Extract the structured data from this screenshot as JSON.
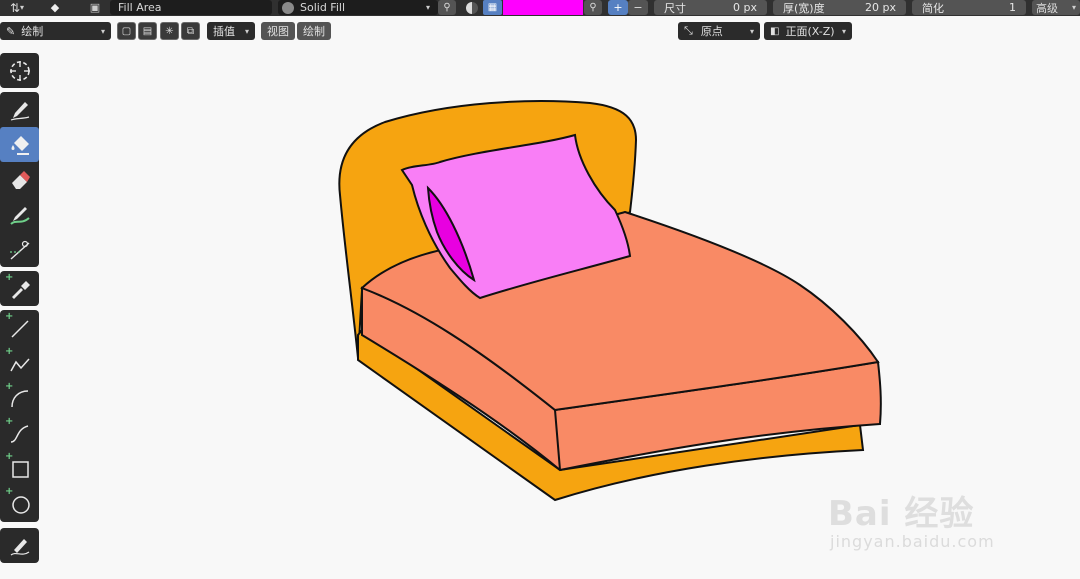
{
  "header": {
    "fill_area": "Fill Area",
    "material_fill": "Solid Fill",
    "brush_color": "#ff00ff",
    "size_label": "尺寸",
    "size_value": "0 px",
    "thickness_label": "厚(宽)度",
    "thickness_value": "20 px",
    "simplify_label": "简化",
    "simplify_value": "1",
    "advanced_label": "高级",
    "add_label": "+",
    "remove_label": "−"
  },
  "subheader": {
    "mode": "绘制",
    "interpolate": "插值",
    "view_menu": "视图",
    "draw_menu": "绘制",
    "origin": "原点",
    "front_view": "正面(X-Z)"
  },
  "toolbar": {
    "tools": [
      {
        "name": "cursor",
        "icon": "crosshair-icon"
      },
      {
        "name": "draw",
        "icon": "pencil-icon"
      },
      {
        "name": "fill",
        "icon": "fill-bucket-icon",
        "active": true
      },
      {
        "name": "erase",
        "icon": "eraser-icon"
      },
      {
        "name": "tint",
        "icon": "tint-brush-icon"
      },
      {
        "name": "cutter",
        "icon": "cutter-icon"
      },
      {
        "name": "eyedropper",
        "icon": "eyedropper-icon"
      },
      {
        "name": "line",
        "icon": "line-icon"
      },
      {
        "name": "polyline",
        "icon": "polyline-icon"
      },
      {
        "name": "arc",
        "icon": "arc-icon"
      },
      {
        "name": "curve",
        "icon": "curve-icon"
      },
      {
        "name": "box",
        "icon": "box-icon"
      },
      {
        "name": "circle",
        "icon": "circle-icon"
      },
      {
        "name": "annotate",
        "icon": "annotate-icon"
      }
    ]
  },
  "canvas": {
    "colors": {
      "headboard": "#f6a410",
      "mattress": "#f98a65",
      "pillow": "#f97ef6",
      "pillow_shadow": "#e800e0",
      "base": "#f6a410",
      "outline": "#111111"
    }
  },
  "watermark": {
    "brand": "Bai 经验",
    "url": "jingyan.baidu.com"
  }
}
